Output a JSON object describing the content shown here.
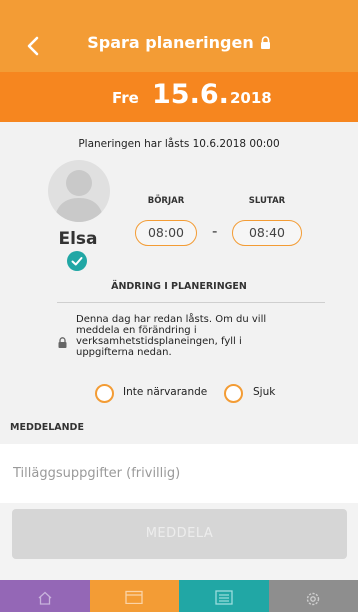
{
  "header": {
    "title": "Spara planeringen"
  },
  "date": {
    "weekday": "Fre",
    "day": "15.6.",
    "year": "2018"
  },
  "lock_status": "Planeringen har låsts 10.6.2018 00:00",
  "child": {
    "name": "Elsa"
  },
  "times": {
    "start_label": "BÖRJAR",
    "start_value": "08:00",
    "separator": "-",
    "end_label": "SLUTAR",
    "end_value": "08:40"
  },
  "change_section": {
    "title": "ÄNDRING I PLANERINGEN",
    "notice": "Denna dag har redan låsts. Om du vill meddela en förändring i verksamhetstidsplaneingen, fyll i uppgifterna nedan."
  },
  "options": {
    "absent": "Inte närvarande",
    "sick": "Sjuk"
  },
  "message": {
    "label": "MEDDELANDE",
    "placeholder": "Tilläggsuppgifter (frivillig)",
    "submit": "MEDDELA"
  },
  "tabs": [
    {
      "icon": "home-icon",
      "color": "#9467b6"
    },
    {
      "icon": "calendar-icon",
      "color": "#f39c35"
    },
    {
      "icon": "messages-icon",
      "color": "#21a7a5"
    },
    {
      "icon": "settings-icon",
      "color": "#8e8e8e"
    }
  ],
  "colors": {
    "header": "#f39c35",
    "datebar": "#f6861f",
    "accent": "#21a7a5"
  }
}
